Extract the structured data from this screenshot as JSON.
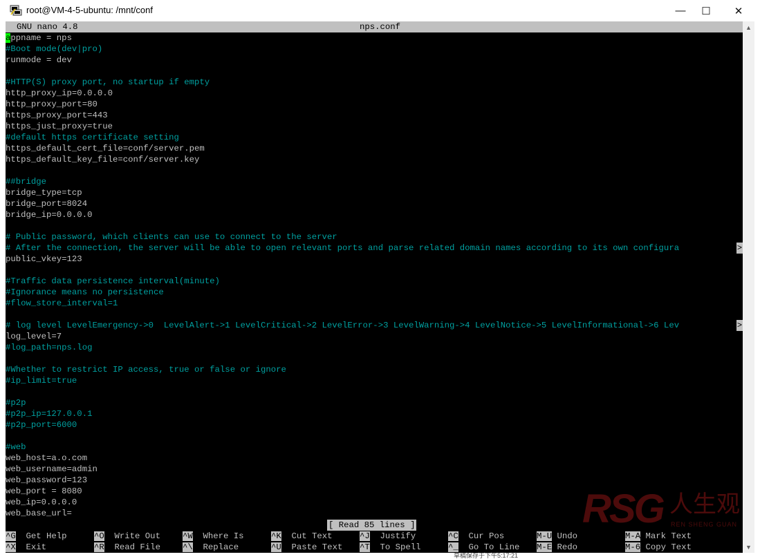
{
  "window": {
    "title": "root@VM-4-5-ubuntu: /mnt/conf",
    "minimize_glyph": "—",
    "maximize_glyph": "☐",
    "close_glyph": "✕",
    "app_icon": "putty-terminal-icon"
  },
  "nano": {
    "version_label": "GNU nano 4.8",
    "filename": "nps.conf",
    "cursor_char": "a",
    "overflow_marker": ">",
    "status_message": "[ Read 85 lines ]"
  },
  "lines": [
    {
      "text": "ppname = nps",
      "kind": "first"
    },
    {
      "text": "#Boot mode(dev|pro)",
      "kind": "comment"
    },
    {
      "text": "runmode = dev",
      "kind": "plain"
    },
    {
      "text": "",
      "kind": "plain"
    },
    {
      "text": "#HTTP(S) proxy port, no startup if empty",
      "kind": "comment"
    },
    {
      "text": "http_proxy_ip=0.0.0.0",
      "kind": "plain"
    },
    {
      "text": "http_proxy_port=80",
      "kind": "plain"
    },
    {
      "text": "https_proxy_port=443",
      "kind": "plain"
    },
    {
      "text": "https_just_proxy=true",
      "kind": "plain"
    },
    {
      "text": "#default https certificate setting",
      "kind": "comment"
    },
    {
      "text": "https_default_cert_file=conf/server.pem",
      "kind": "plain"
    },
    {
      "text": "https_default_key_file=conf/server.key",
      "kind": "plain"
    },
    {
      "text": "",
      "kind": "plain"
    },
    {
      "text": "##bridge",
      "kind": "comment"
    },
    {
      "text": "bridge_type=tcp",
      "kind": "plain"
    },
    {
      "text": "bridge_port=8024",
      "kind": "plain"
    },
    {
      "text": "bridge_ip=0.0.0.0",
      "kind": "plain"
    },
    {
      "text": "",
      "kind": "plain"
    },
    {
      "text": "# Public password, which clients can use to connect to the server",
      "kind": "comment"
    },
    {
      "text": "# After the connection, the server will be able to open relevant ports and parse related domain names according to its own configura",
      "kind": "comment",
      "overflow": true
    },
    {
      "text": "public_vkey=123",
      "kind": "plain"
    },
    {
      "text": "",
      "kind": "plain"
    },
    {
      "text": "#Traffic data persistence interval(minute)",
      "kind": "comment"
    },
    {
      "text": "#Ignorance means no persistence",
      "kind": "comment"
    },
    {
      "text": "#flow_store_interval=1",
      "kind": "comment"
    },
    {
      "text": "",
      "kind": "plain"
    },
    {
      "text": "# log level LevelEmergency->0  LevelAlert->1 LevelCritical->2 LevelError->3 LevelWarning->4 LevelNotice->5 LevelInformational->6 Lev",
      "kind": "comment",
      "overflow": true
    },
    {
      "text": "log_level=7",
      "kind": "plain"
    },
    {
      "text": "#log_path=nps.log",
      "kind": "comment"
    },
    {
      "text": "",
      "kind": "plain"
    },
    {
      "text": "#Whether to restrict IP access, true or false or ignore",
      "kind": "comment"
    },
    {
      "text": "#ip_limit=true",
      "kind": "comment"
    },
    {
      "text": "",
      "kind": "plain"
    },
    {
      "text": "#p2p",
      "kind": "comment"
    },
    {
      "text": "#p2p_ip=127.0.0.1",
      "kind": "comment"
    },
    {
      "text": "#p2p_port=6000",
      "kind": "comment"
    },
    {
      "text": "",
      "kind": "plain"
    },
    {
      "text": "#web",
      "kind": "comment"
    },
    {
      "text": "web_host=a.o.com",
      "kind": "plain"
    },
    {
      "text": "web_username=admin",
      "kind": "plain"
    },
    {
      "text": "web_password=123",
      "kind": "plain"
    },
    {
      "text": "web_port = 8080",
      "kind": "plain"
    },
    {
      "text": "web_ip=0.0.0.0",
      "kind": "plain"
    },
    {
      "text": "web_base_url=",
      "kind": "plain"
    }
  ],
  "shortcuts": [
    [
      {
        "key": "^G",
        "label": "Get Help"
      },
      {
        "key": "^O",
        "label": "Write Out"
      },
      {
        "key": "^W",
        "label": "Where Is"
      },
      {
        "key": "^K",
        "label": "Cut Text"
      },
      {
        "key": "^J",
        "label": "Justify"
      },
      {
        "key": "^C",
        "label": "Cur Pos"
      },
      {
        "key": "M-U",
        "label": "Undo"
      },
      {
        "key": "M-A",
        "label": "Mark Text"
      }
    ],
    [
      {
        "key": "^X",
        "label": "Exit"
      },
      {
        "key": "^R",
        "label": "Read File"
      },
      {
        "key": "^\\",
        "label": "Replace"
      },
      {
        "key": "^U",
        "label": "Paste Text"
      },
      {
        "key": "^T",
        "label": "To Spell"
      },
      {
        "key": "^_",
        "label": "Go To Line"
      },
      {
        "key": "M-E",
        "label": "Redo"
      },
      {
        "key": "M-6",
        "label": "Copy Text"
      }
    ]
  ],
  "scrollbar": {
    "up_glyph": "▲",
    "down_glyph": "▼"
  },
  "taskbar_hint": "草稿保存于下午5:17:21",
  "watermark": {
    "logo": "RSG",
    "cn": "人生观",
    "sub": "REN SHENG GUAN"
  },
  "colors": {
    "terminal_bg": "#000000",
    "text": "#c0c0c0",
    "comment": "#00a0a0",
    "cursor": "#00ff00",
    "bar": "#c0c0c0"
  }
}
